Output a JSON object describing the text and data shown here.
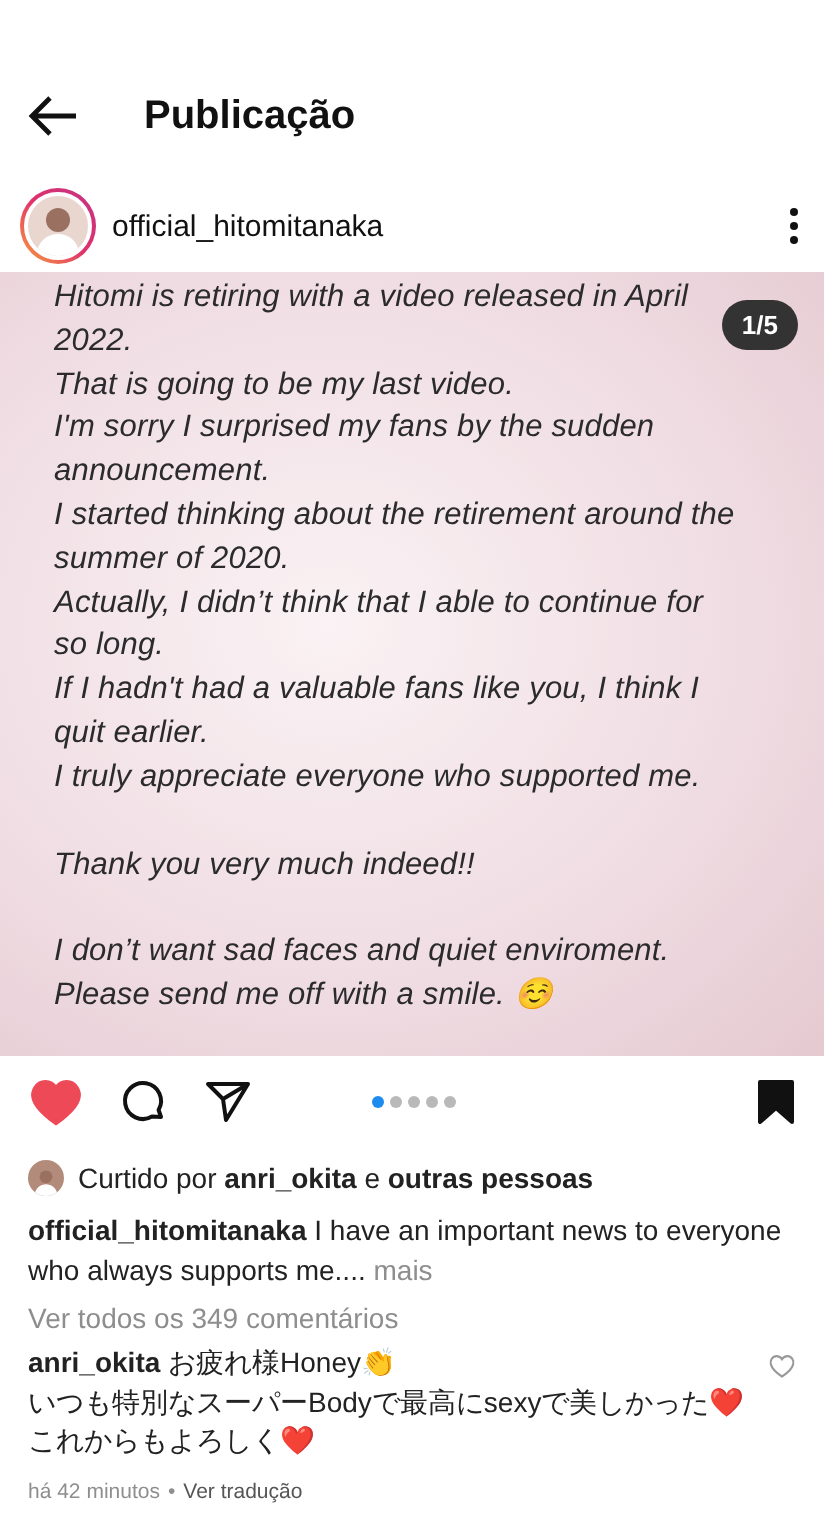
{
  "header": {
    "title": "Publicação"
  },
  "post": {
    "username": "official_hitomitanaka",
    "has_story": true,
    "image_counter": "1/5",
    "image_text": [
      [
        "Hitomi is retiring with a video released in April",
        "2022.",
        "That is going to be my last video.",
        "I'm sorry I surprised my fans by the sudden",
        "announcement.",
        "I started thinking about the retirement around the",
        "summer of 2020.",
        "Actually, I didn’t think that I able to continue for",
        "so long.",
        "If I hadn't had a valuable fans like you, I think I",
        "quit earlier.",
        "I truly appreciate everyone who supported me."
      ],
      [
        "Thank you very much indeed!!"
      ],
      [
        "I don’t want sad faces and quiet enviroment.",
        "Please send me off with a smile. ☺️"
      ]
    ],
    "liked": true,
    "saved": true,
    "carousel_dots": [
      {
        "selected": true
      },
      {
        "selected": false
      },
      {
        "selected": false
      },
      {
        "selected": false
      },
      {
        "selected": false
      }
    ],
    "likes": {
      "prefix": "Curtido por",
      "user": "anri_okita",
      "joiner": "e",
      "others": "outras pessoas"
    },
    "caption": {
      "user": "official_hitomitanaka",
      "text": "I have an important news to everyone who always supports me....",
      "more": "mais"
    },
    "view_comments": "Ver todos os 349 comentários",
    "comments": [
      {
        "user": "anri_okita",
        "lines": [
          "お疲れ様Honey👏",
          "いつも特別なスーパーBodyで最高にsexyで美しかった❤️",
          "これからもよろしく❤️"
        ],
        "liked": false,
        "time": "há 42 minutos",
        "separator": "•",
        "translate": "Ver tradução"
      }
    ]
  }
}
